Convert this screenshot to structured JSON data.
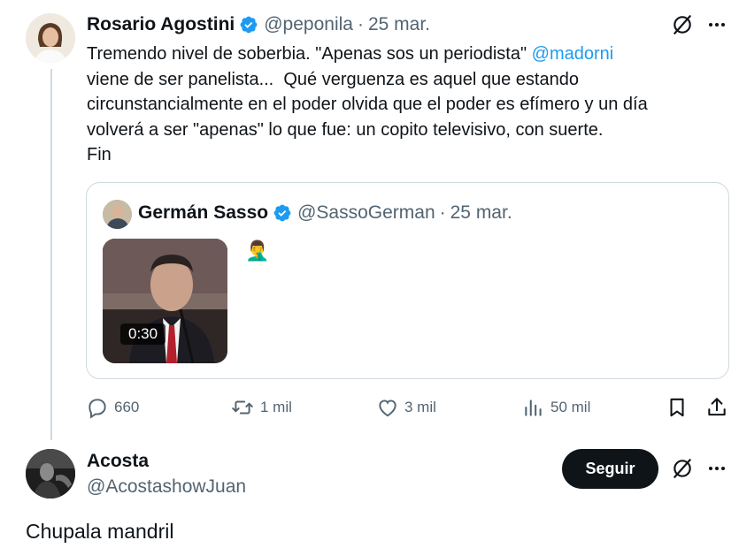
{
  "tweet": {
    "author_name": "Rosario Agostini",
    "author_handle": "@peponila",
    "separator": "·",
    "date": "25 mar.",
    "text_before_mention": "Tremendo nivel de soberbia. \"Apenas sos un periodista\" ",
    "mention": "@madorni",
    "text_after_mention": "\nviene de ser panelista...  Qué verguenza es aquel que estando\ncircunstancialmente en el poder olvida que el poder es efímero y un día\nvolverá a ser \"apenas\" lo que fue: un copito televisivo, con suerte.\nFin",
    "icons": {
      "grok": "no-entry-icon",
      "more": "more-dots-icon",
      "verified": "verified-badge-icon"
    }
  },
  "quote": {
    "author_name": "Germán Sasso",
    "author_handle": "@SassoGerman",
    "separator": "·",
    "date": "25 mar.",
    "emoji": "🤦‍♂️",
    "video_duration": "0:30"
  },
  "actions": {
    "replies": "660",
    "reposts": "1 mil",
    "likes": "3 mil",
    "views": "50 mil"
  },
  "reply": {
    "author_name": "Acosta",
    "author_handle": "@AcostashowJuan",
    "follow_label": "Seguir",
    "text": "Chupala mandril"
  },
  "colors": {
    "text": "#0f1419",
    "secondary": "#536471",
    "link": "#1d9bf0",
    "verified": "#1d9bf0",
    "border": "#cfd9de",
    "follow_bg": "#0f1419"
  }
}
